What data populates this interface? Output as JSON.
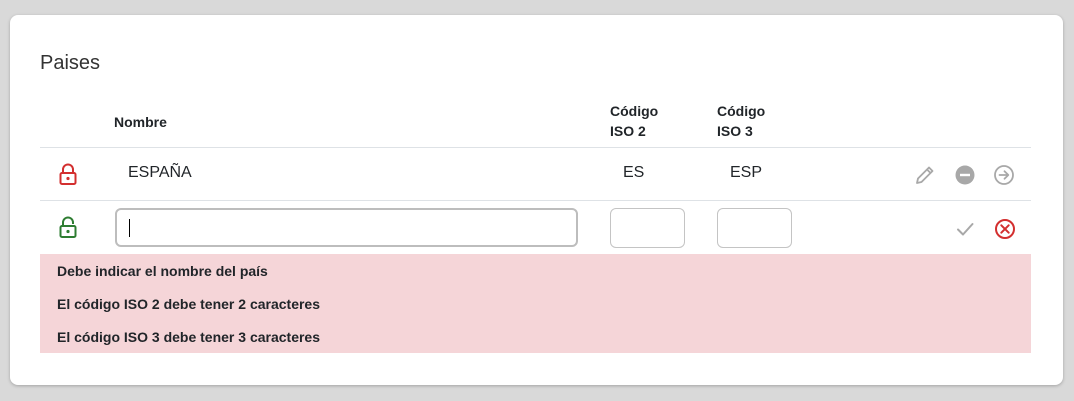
{
  "title": "Paises",
  "columns": {
    "nombre": "Nombre",
    "iso2_line1": "Código",
    "iso2_line2": "ISO 2",
    "iso3_line1": "Código",
    "iso3_line2": "ISO 3"
  },
  "rows": [
    {
      "locked": true,
      "nombre": "ESPAÑA",
      "iso2": "ES",
      "iso3": "ESP",
      "actions": [
        "edit-icon",
        "remove-icon",
        "go-icon"
      ]
    }
  ],
  "new_row": {
    "locked": false,
    "nombre_value": "",
    "iso2_value": "",
    "iso3_value": "",
    "actions": [
      "check-icon",
      "cancel-icon"
    ]
  },
  "errors": [
    "Debe indicar el nombre del país",
    "El código ISO 2 debe tener 2 caracteres",
    "El código ISO 3 debe tener 3 caracteres"
  ],
  "colors": {
    "locked": "#d32f2f",
    "unlocked": "#2e7d32",
    "error_bg": "#f5d5d8",
    "cancel": "#d32f2f",
    "muted_icon": "#9e9e9e"
  }
}
